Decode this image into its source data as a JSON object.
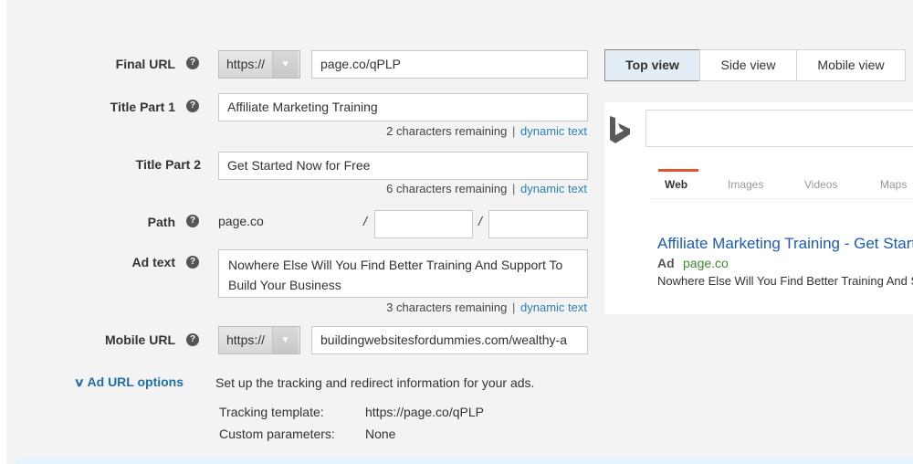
{
  "form": {
    "final_url": {
      "label": "Final URL",
      "protocol": "https://",
      "value": "page.co/qPLP"
    },
    "title_part_1": {
      "label": "Title Part 1",
      "value": "Affiliate Marketing Training",
      "remaining": "2 characters remaining",
      "separator": "|",
      "dynamic_text_link": "dynamic text"
    },
    "title_part_2": {
      "label": "Title Part 2",
      "value": "Get Started Now for Free",
      "remaining": "6 characters remaining",
      "separator": "|",
      "dynamic_text_link": "dynamic text"
    },
    "path": {
      "label": "Path",
      "domain": "page.co",
      "slash": "/",
      "path1": "",
      "path2": ""
    },
    "ad_text": {
      "label": "Ad text",
      "value": "Nowhere Else Will You Find Better Training And Support To Build Your Business",
      "remaining": "3 characters remaining",
      "separator": "|",
      "dynamic_text_link": "dynamic text"
    },
    "mobile_url": {
      "label": "Mobile URL",
      "protocol": "https://",
      "value": "buildingwebsitesfordummies.com/wealthy-a"
    },
    "help_glyph": "?",
    "dropdown_glyph": "▼"
  },
  "ad_url_options": {
    "toggle_label": "Ad URL options",
    "chevron": "∨",
    "description": "Set up the tracking and redirect information for your ads.",
    "tracking_template_label": "Tracking template:",
    "tracking_template_value": "https://page.co/qPLP",
    "custom_parameters_label": "Custom parameters:",
    "custom_parameters_value": "None"
  },
  "preview": {
    "tabs": [
      {
        "label": "Top view",
        "active": true
      },
      {
        "label": "Side view",
        "active": false
      },
      {
        "label": "Mobile view",
        "active": false
      }
    ],
    "search_nav": [
      "Web",
      "Images",
      "Videos",
      "Maps"
    ],
    "active_nav": "Web",
    "ad": {
      "title": "Affiliate Marketing Training - Get Started Now for Free",
      "badge": "Ad",
      "display_url": "page.co",
      "description": "Nowhere Else Will You Find Better Training And Support To Build Your Business"
    },
    "colors": {
      "accent": "#e2532f",
      "ad_title": "#1a5bb5",
      "ad_url": "#3e8a2e"
    }
  }
}
